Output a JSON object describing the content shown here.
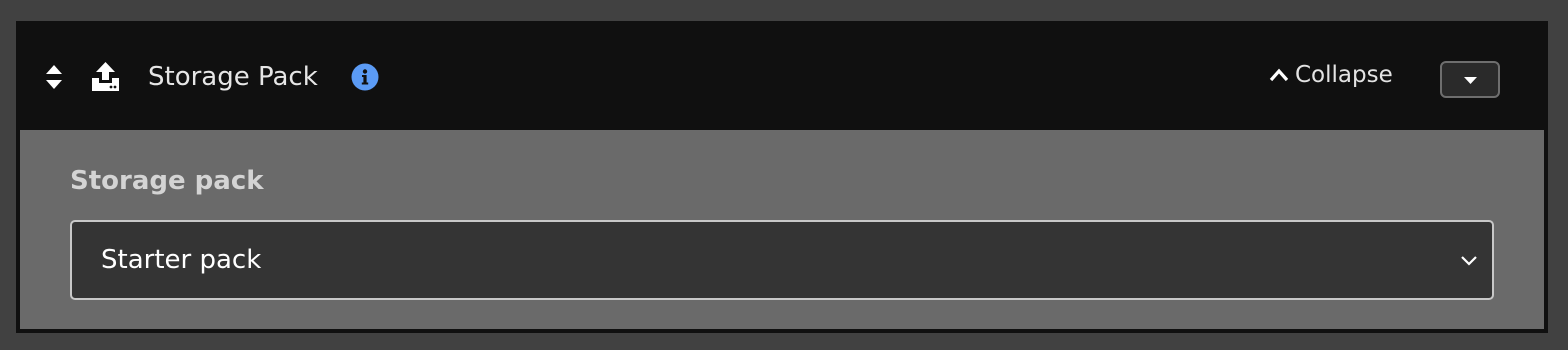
{
  "panel": {
    "title": "Storage Pack",
    "collapse_label": "Collapse",
    "icons": {
      "sort": "sort-icon",
      "upload": "upload-icon",
      "info": "info-icon",
      "collapse": "chevron-up-icon",
      "menu": "caret-down-icon"
    },
    "colors": {
      "info_accent": "#5b9bf5",
      "header_background": "#101010",
      "body_background": "#6a6a6a"
    }
  },
  "field": {
    "label": "Storage pack",
    "selected_value": "Starter pack"
  }
}
